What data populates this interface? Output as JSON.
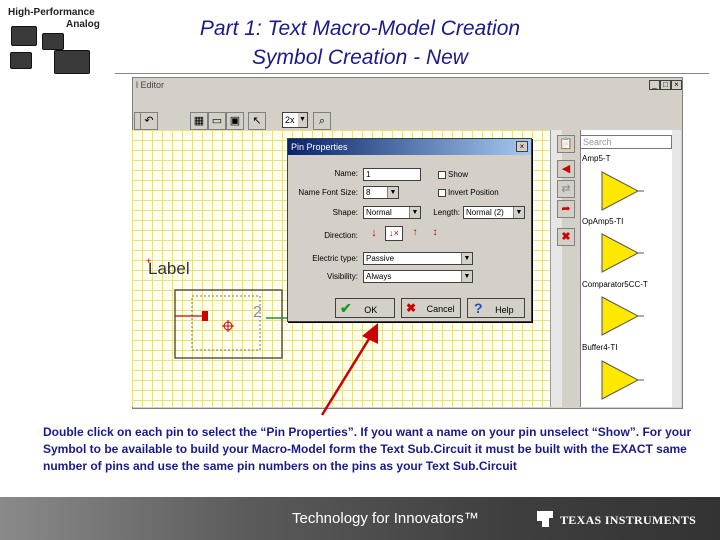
{
  "header": {
    "logo_line1": "High-Performance",
    "logo_line2": "Analog",
    "title_line1": "Part 1: Text Macro-Model Creation",
    "title_line2": "Symbol Creation - New"
  },
  "app": {
    "window_title": "l Editor",
    "zoom_value": "2x",
    "window_buttons": [
      "_",
      "□",
      "×"
    ],
    "canvas_label": "Label",
    "pin_number": "2"
  },
  "library": {
    "search_placeholder": "Search",
    "items": [
      "Amp5-T",
      "OpAmp5-TI",
      "Comparator5CC-T",
      "Buffer4-TI"
    ]
  },
  "dialog": {
    "title": "Pin Properties",
    "close_label": "×",
    "name_label": "Name:",
    "name_value": "1",
    "show_label": "Show",
    "font_size_label": "Name Font Size:",
    "font_size_value": "8",
    "invert_label": "Invert Position",
    "shape_label": "Shape:",
    "shape_value": "Normal",
    "length_label": "Length:",
    "length_value": "Normal (2)",
    "direction_label": "Direction:",
    "electric_type_label": "Electric type:",
    "electric_type_value": "Passive",
    "visibility_label": "Visibility:",
    "visibility_value": "Always",
    "ok_label": "OK",
    "cancel_label": "Cancel",
    "help_label": "Help",
    "show_checked": false,
    "invert_checked": false
  },
  "caption": "Double click on each pin to select the “Pin Properties”.  If you want a name on your pin unselect “Show”. For your Symbol to be available to build your Macro-Model form the Text Sub.Circuit it must be built with the EXACT same number of pins and use the same pin numbers on the pins as your Text Sub.Circuit",
  "footer": {
    "tagline": "Technology for Innovators™",
    "brand": "TEXAS INSTRUMENTS"
  },
  "colors": {
    "title_blue": "#1a1a8c",
    "dialog_title_bar": "#0a246a",
    "arrow_red": "#cc0000",
    "opamp_yellow": "#ffe800",
    "grid_yellow": "#e8e082"
  }
}
